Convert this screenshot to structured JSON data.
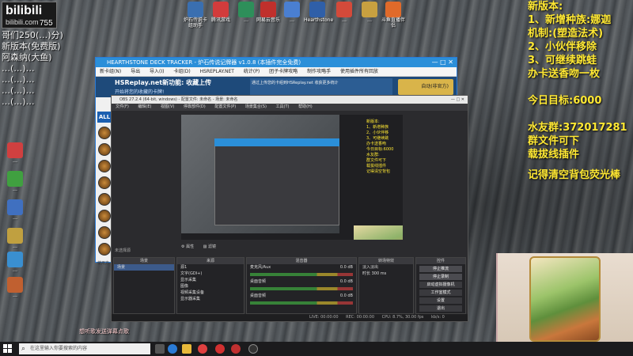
{
  "stream": {
    "logo": "bilibili",
    "logo_sub": "bilibili.com",
    "room": "755"
  },
  "left_overlay": [
    "哥们250(…)分)",
    "新版本(免费版)",
    "阿森纳(大鱼)",
    "…(…)…",
    "…(…)…",
    "…(…)…",
    "…(…)…"
  ],
  "desktop_icons": [
    {
      "label": "炉石传说卡组助手",
      "color": "#3a6fb0"
    },
    {
      "label": "腾讯游戏",
      "color": "#d23c3c"
    },
    {
      "label": "…",
      "color": "#2e8f5a"
    },
    {
      "label": "网易云音乐",
      "color": "#c0302c"
    },
    {
      "label": "…",
      "color": "#4a7fd1"
    },
    {
      "label": "Hearthstone",
      "color": "#2f5fa8"
    },
    {
      "label": "…",
      "color": "#d34a3a"
    },
    {
      "label": "…",
      "color": "#c8a040"
    },
    {
      "label": "斗鱼直播伴侣",
      "color": "#e06a2a"
    }
  ],
  "left_icons": [
    {
      "label": "…",
      "color": "#d04040"
    },
    {
      "label": "…",
      "color": "#40a040"
    },
    {
      "label": "…",
      "color": "#4070c0"
    },
    {
      "label": "…",
      "color": "#c0a040"
    },
    {
      "label": "…",
      "color": "#3a8fd0"
    },
    {
      "label": "…",
      "color": "#c06030"
    }
  ],
  "right_overlay": {
    "heading": "新版本:",
    "line1": "1、新增种族:娜迦",
    "line2": "机制:(塑造法术)",
    "line3": "2、小伙伴移除",
    "line4": "3、可继续跳蛙",
    "line5": "办卡送香吻一枚",
    "goal": "今日目标:6000",
    "group": "水友群:372017281",
    "files": "群文件可下",
    "plugin": "载拔线插件",
    "tip": "记得清空背包荧光棒"
  },
  "hdt": {
    "title": "HEARTHSTONE DECK TRACKER - 炉石传说记牌器 v1.0.8 (本插件完全免费)",
    "controls": "—  □  ✕",
    "menu": [
      "新卡组(N)",
      "导出",
      "导入(I)",
      "卡组(D)",
      "HSREPLAY.NET",
      "统计(P)",
      "团子卡牌攻略",
      "制作攻略手",
      "使用插件所有回放"
    ],
    "banner_title": "HSReplay.net新功能: 收藏上传",
    "banner_sub": "开始将您的收藏的卡牌!",
    "banner_mid": "通过上传您的卡组到HSReplay.net 收获更多统计",
    "banner_button": "自动(非官方)",
    "all_label": "ALL",
    "footer": "使用方"
  },
  "obs": {
    "title": "OBS 27.2.4 (64-bit, windows) - 配置文件: 未命名 - 场景: 未命名",
    "controls": "—  □  ✕",
    "menu": [
      "文件(F)",
      "编辑(E)",
      "视图(V)",
      "停靠部件(D)",
      "配置文件(P)",
      "场景集合(S)",
      "工具(T)",
      "帮助(H)"
    ],
    "preview_text": [
      "新版本:",
      "1、新增种族",
      "2、小伙伴移",
      "3、可继续跳",
      "办卡送香吻",
      "今日目标:6000",
      "水友群:",
      "群文件可下",
      "载拔线插件",
      "记得清空背包"
    ],
    "scene_label": "未选择源",
    "toolbar": [
      "⚙ 属性",
      "▨ 滤镜"
    ],
    "docks": {
      "scenes": {
        "header": "场景",
        "items": [
          "场景"
        ]
      },
      "sources": {
        "header": "来源",
        "items": [
          "源1",
          "文字(GDI+)",
          "显示采集",
          "图像",
          "视频采集设备",
          "显示器采集"
        ]
      },
      "mixer": {
        "header": "混音器",
        "items": [
          "麦克风/Aux",
          "桌面音频",
          "桌面音频"
        ],
        "values": [
          "0.0 dB",
          "0.0 dB",
          "0.0 dB"
        ]
      },
      "transitions": {
        "header": "转场特效",
        "items": [
          "淡入淡出",
          "时长",
          "300 ms"
        ]
      },
      "controls": {
        "header": "控件",
        "buttons": [
          "停止推流",
          "停止录制",
          "启动虚拟摄像机",
          "工作室模式",
          "设置",
          "退出"
        ]
      }
    },
    "status": [
      "LIVE: 00:00:00",
      "REC: 00:00:00",
      "CPU: 8.7%, 30.00 fps",
      "kb/s: 0"
    ]
  },
  "bottom_overlay": "想听歌发送弹幕点歌",
  "taskbar": {
    "search_placeholder": "在这里输入你要搜索的内容"
  }
}
